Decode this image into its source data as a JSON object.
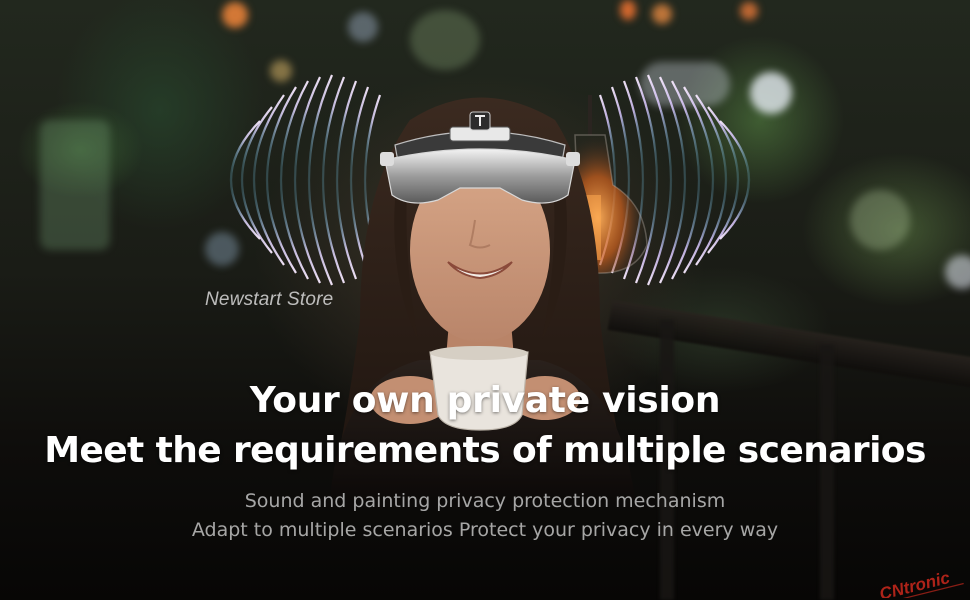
{
  "watermark": "Newstart Store",
  "headline": {
    "line1": "Your own private vision",
    "line2": "Meet the requirements of multiple scenarios"
  },
  "subtitle": {
    "line1": "Sound and painting privacy protection mechanism",
    "line2": "Adapt to multiple scenarios Protect your privacy in every way"
  },
  "corner_logo": {
    "text": "CNtronic",
    "color": "#c0271c"
  },
  "colors": {
    "headline": "#ffffff",
    "subtitle": "#d2d2d2",
    "background": "#0b0a08"
  }
}
